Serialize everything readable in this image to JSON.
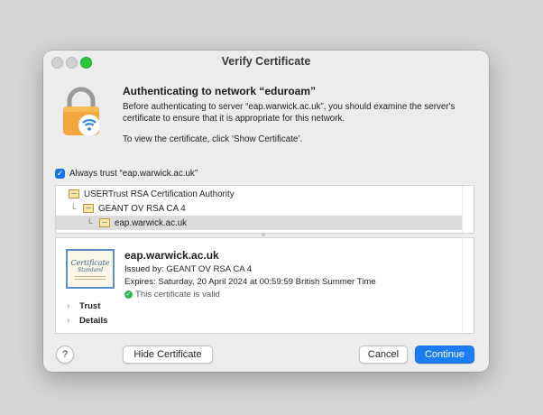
{
  "window": {
    "title": "Verify Certificate"
  },
  "header": {
    "heading": "Authenticating to network “eduroam”",
    "body": "Before authenticating to server “eap.warwick.ac.uk”, you should examine the server's certificate to ensure that it is appropriate for this network.",
    "instruction": "To view the certificate, click ‘Show Certificate’."
  },
  "always_trust": {
    "label": "Always trust “eap.warwick.ac.uk”",
    "checked": true
  },
  "chain": [
    {
      "label": "USERTrust RSA Certification Authority",
      "selected": false
    },
    {
      "label": "GEANT OV RSA CA 4",
      "selected": false
    },
    {
      "label": "eap.warwick.ac.uk",
      "selected": true
    }
  ],
  "certificate": {
    "thumb_title": "Certificate",
    "thumb_subtitle": "Standard",
    "name": "eap.warwick.ac.uk",
    "issued_by": "Issued by: GEANT OV RSA CA 4",
    "expires": "Expires: Saturday, 20 April 2024 at 00:59:59 British Summer Time",
    "valid": "This certificate is valid",
    "sections": [
      "Trust",
      "Details"
    ]
  },
  "buttons": {
    "help": "?",
    "hide_certificate": "Hide Certificate",
    "cancel": "Cancel",
    "continue": "Continue"
  },
  "colors": {
    "accent": "#1e7cf2",
    "valid_green": "#31b34a",
    "lock_orange": "#f3a63b"
  },
  "icons": {
    "lock": "lock-wifi-icon",
    "cert": "certificate-icon",
    "check": "checkmark-icon"
  }
}
